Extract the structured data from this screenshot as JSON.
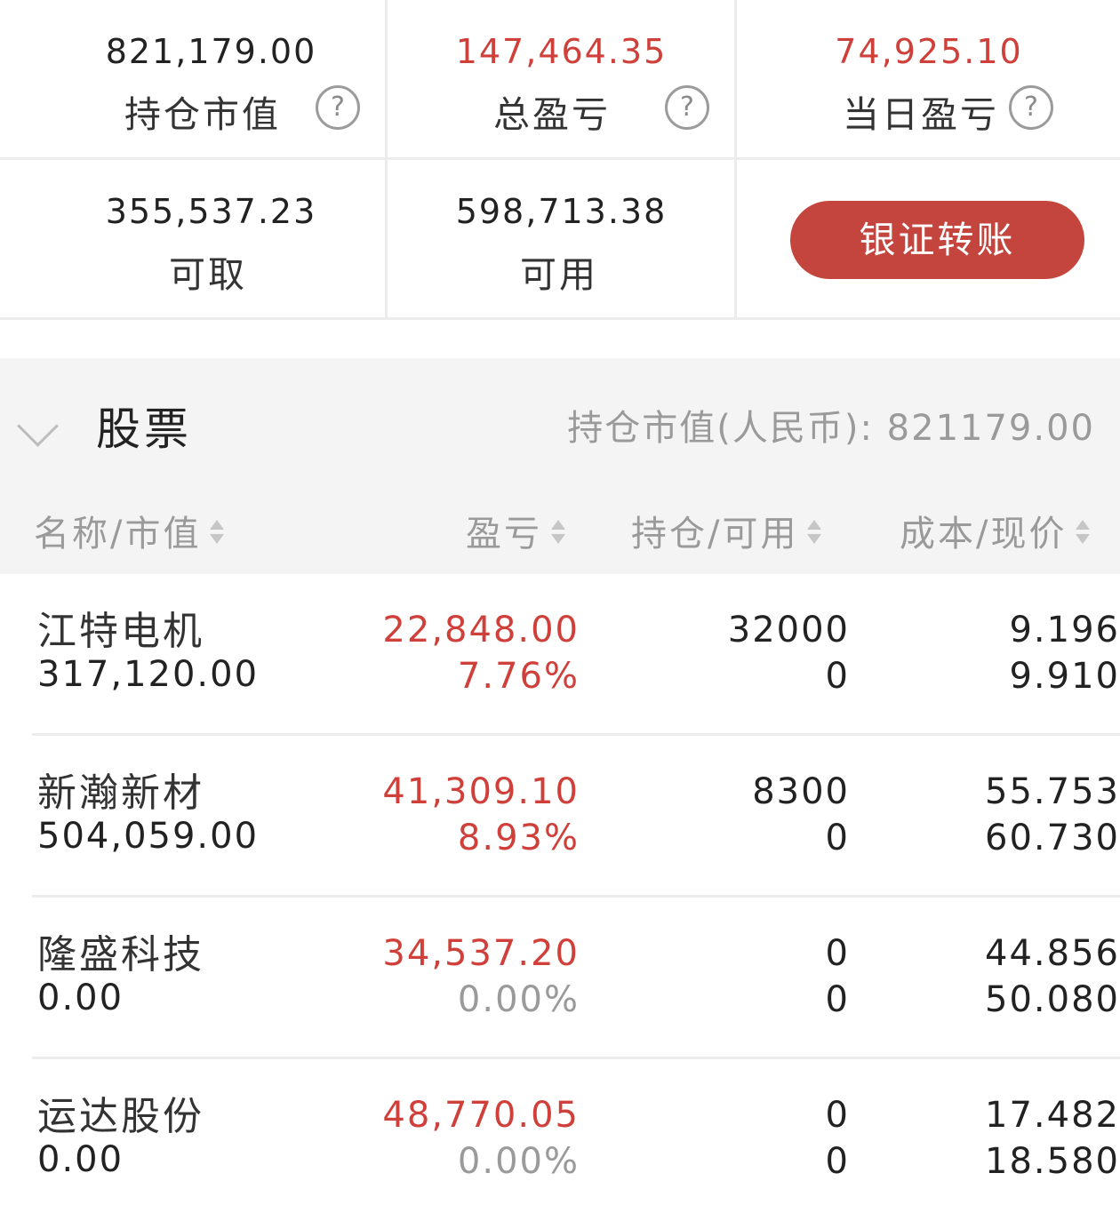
{
  "summary": {
    "market_value": {
      "value": "821,179.00",
      "label": "持仓市值",
      "help": "?"
    },
    "total_pnl": {
      "value": "147,464.35",
      "label": "总盈亏",
      "help": "?"
    },
    "daily_pnl": {
      "value": "74,925.10",
      "label": "当日盈亏",
      "help": "?"
    },
    "withdrawable": {
      "value": "355,537.23",
      "label": "可取"
    },
    "available": {
      "value": "598,713.38",
      "label": "可用"
    },
    "transfer_button": "银证转账"
  },
  "section": {
    "title": "股票",
    "total": "持仓市值(人民币): 821179.00"
  },
  "columns": [
    "名称/市值",
    "盈亏",
    "持仓/可用",
    "成本/现价"
  ],
  "positions": [
    {
      "name": "江特电机",
      "market_value": "317,120.00",
      "pnl": "22,848.00",
      "pnl_pct": "7.76%",
      "holding": "32000",
      "available": "0",
      "cost": "9.196",
      "price": "9.910"
    },
    {
      "name": "新瀚新材",
      "market_value": "504,059.00",
      "pnl": "41,309.10",
      "pnl_pct": "8.93%",
      "holding": "8300",
      "available": "0",
      "cost": "55.753",
      "price": "60.730"
    },
    {
      "name": "隆盛科技",
      "market_value": "0.00",
      "pnl": "34,537.20",
      "pnl_pct": "0.00%",
      "holding": "0",
      "available": "0",
      "cost": "44.856",
      "price": "50.080"
    },
    {
      "name": "运达股份",
      "market_value": "0.00",
      "pnl": "48,770.05",
      "pnl_pct": "0.00%",
      "holding": "0",
      "available": "0",
      "cost": "17.482",
      "price": "18.580"
    }
  ],
  "colors": {
    "accent_red": "#c4453d",
    "profit_red": "#d0403a",
    "muted_grey": "#9a9a9a"
  }
}
